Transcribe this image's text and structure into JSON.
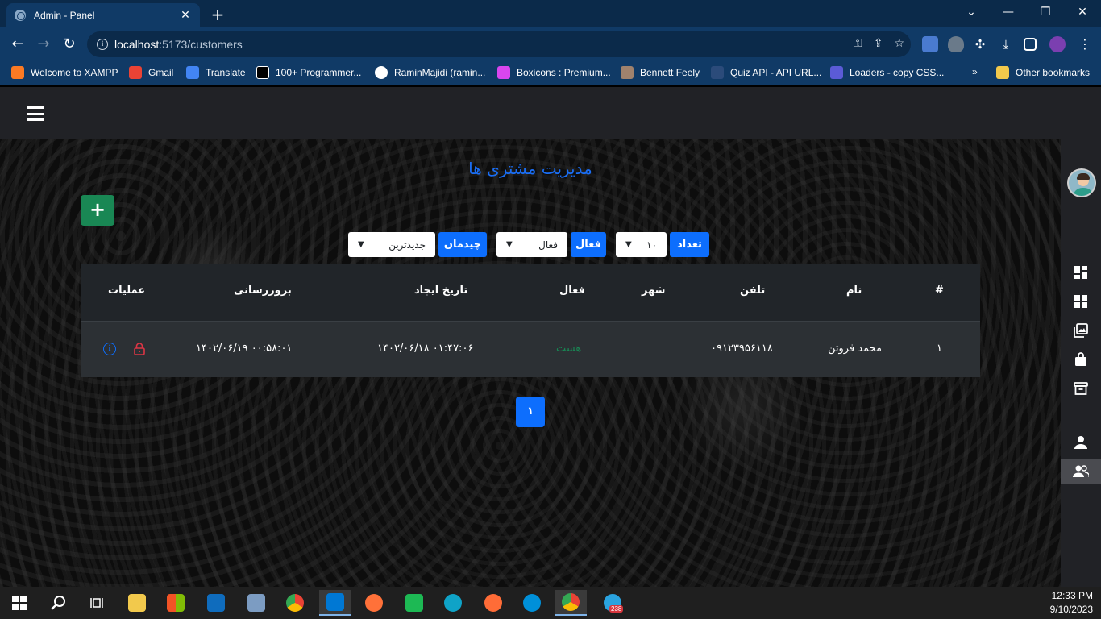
{
  "browser": {
    "tab_title": "Admin - Panel",
    "url_host": "localhost",
    "url_path": ":5173/customers",
    "bookmarks": [
      {
        "label": "Welcome to XAMPP",
        "color": "#fb7a24"
      },
      {
        "label": "Gmail",
        "color": "#ea4335"
      },
      {
        "label": "Translate",
        "color": "#4285f4"
      },
      {
        "label": "100+ Programmer...",
        "color": "#000000"
      },
      {
        "label": "RaminMajidi (ramin...",
        "color": "#ffffff"
      },
      {
        "label": "Boxicons : Premium...",
        "color": "#d946ef"
      },
      {
        "label": "Bennett Feely",
        "color": "#a0826d"
      },
      {
        "label": "Quiz API - API URL...",
        "color": "#2b4b7a"
      },
      {
        "label": "Loaders - copy CSS...",
        "color": "#5b5bd6"
      }
    ],
    "other_bookmarks": "Other bookmarks",
    "overflow": "»"
  },
  "page": {
    "title": "مدیریت مشتری ها",
    "add_button": "+"
  },
  "controls": {
    "count_label": "تعداد",
    "count_value": "۱۰",
    "active_label": "فعال",
    "active_value": "فعال",
    "sort_label": "چیدمان",
    "sort_value": "جدیدترین"
  },
  "table": {
    "headers": {
      "index": "#",
      "name": "نام",
      "phone": "تلفن",
      "city": "شهر",
      "active": "فعال",
      "created": "تاریخ ایجاد",
      "updated": "بروزرسانی",
      "operations": "عملیات"
    },
    "rows": [
      {
        "index": "۱",
        "name": "محمد فروتن",
        "phone": "۰۹۱۲۳۹۵۶۱۱۸",
        "city": "",
        "active": "هست",
        "created": "۱۴۰۲/۰۶/۱۸ ۰۱:۴۷:۰۶",
        "updated": "۱۴۰۲/۰۶/۱۹ ۰۰:۵۸:۰۱"
      }
    ]
  },
  "pagination": {
    "current": "۱"
  },
  "taskbar": {
    "time": "12:33 PM",
    "date": "9/10/2023",
    "telegram_badge": "238"
  },
  "colors": {
    "accent": "#0d6efd",
    "success": "#198754",
    "danger": "#dc3545",
    "title_blue": "#1a6ef5"
  }
}
